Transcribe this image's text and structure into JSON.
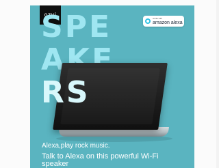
{
  "ad": {
    "brand": "ozvi",
    "hero_lines": [
      "SPE",
      "AKE",
      "RS"
    ],
    "alexa_badge": {
      "small_text": "works with",
      "big_text": "amazon alexa",
      "icon": "alexa-ring-icon"
    },
    "copy": {
      "line1": "Alexa,play rock music.",
      "line2": "Talk to Alexa on this powerful Wi-Fi speaker"
    },
    "colors": {
      "background": "#5ab4c0",
      "hero_text": "#9fe6f1",
      "hero_text_last": "#d8f7fb",
      "alexa_ring": "#33c3e5"
    }
  }
}
